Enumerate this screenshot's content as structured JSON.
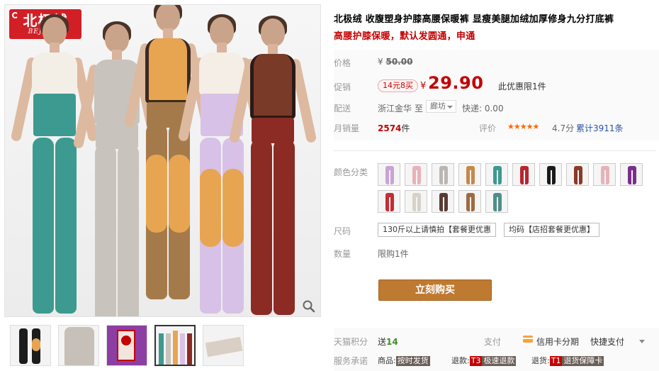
{
  "brand": {
    "name_cn": "北极绒",
    "name_en": "BEJIROG"
  },
  "gallery": {
    "main_image": "Five models wearing high-waist fleece-lined leggings",
    "thumbnails": [
      "black-knee-pad",
      "grey-high-waist",
      "product-tag",
      "five-models",
      "fleece-fabric"
    ],
    "active_thumbnail": 3
  },
  "product": {
    "title": "北极绒 收腹塑身护膝高腰保暖裤 显瘦美腿加绒加厚修身九分打底裤",
    "subtitle": "高腰护膝保暖，默认发圆通，申通"
  },
  "price": {
    "label": "价格",
    "currency": "¥",
    "original": "50.00"
  },
  "promo": {
    "label": "促销",
    "tag": "14元8买",
    "currency": "¥",
    "price": "29.90",
    "note": "此优惠限1件"
  },
  "shipping": {
    "label": "配送",
    "from": "浙江金华",
    "to_label": "至",
    "to": "廊坊",
    "express": "快递: 0.00"
  },
  "sales": {
    "label": "月销量",
    "count": "2574",
    "unit": "件"
  },
  "rating": {
    "label": "评价",
    "stars": "★★★★★",
    "score": "4.7分",
    "reviews": "累计3911条",
    "color": "#ff6600"
  },
  "colors": {
    "label": "颜色分类",
    "swatches": [
      {
        "color": "#c9a3d6"
      },
      {
        "color": "#e8b1b8"
      },
      {
        "color": "#b9b6b4"
      },
      {
        "color": "#c6884b"
      },
      {
        "color": "#3c9a90"
      },
      {
        "color": "#b8262d"
      },
      {
        "color": "#1a1a1a"
      },
      {
        "color": "#8b3a2a"
      },
      {
        "color": "#e6b2b8"
      },
      {
        "color": "#7a2e8e"
      },
      {
        "color": "#c22e33"
      },
      {
        "color": "#d8d1c7"
      },
      {
        "color": "#5a3b34"
      },
      {
        "color": "#a06a3e"
      },
      {
        "color": "#4e8f8a"
      }
    ]
  },
  "size": {
    "label": "尺码",
    "options": [
      "130斤以上请慎拍【套餐更优惠",
      "均码【店招套餐更优惠】"
    ]
  },
  "quantity": {
    "label": "数量",
    "text": "限购1件"
  },
  "buy": {
    "label": "立刻购买",
    "color": "#bf7a31"
  },
  "points": {
    "label": "天猫积分",
    "prefix": "送",
    "value": "14"
  },
  "payment": {
    "label": "支付",
    "card": "信用卡分期",
    "quick": "快捷支付"
  },
  "service": {
    "label": "服务承诺",
    "goods_label": "商品:",
    "goods_badge": "按时发货",
    "refund_label": "退款:",
    "refund_code": "T3",
    "refund_badge": "极速退款",
    "return_label": "退货:",
    "return_code": "T1",
    "return_badge": "退货保障卡"
  },
  "accent_color": "#c40000"
}
